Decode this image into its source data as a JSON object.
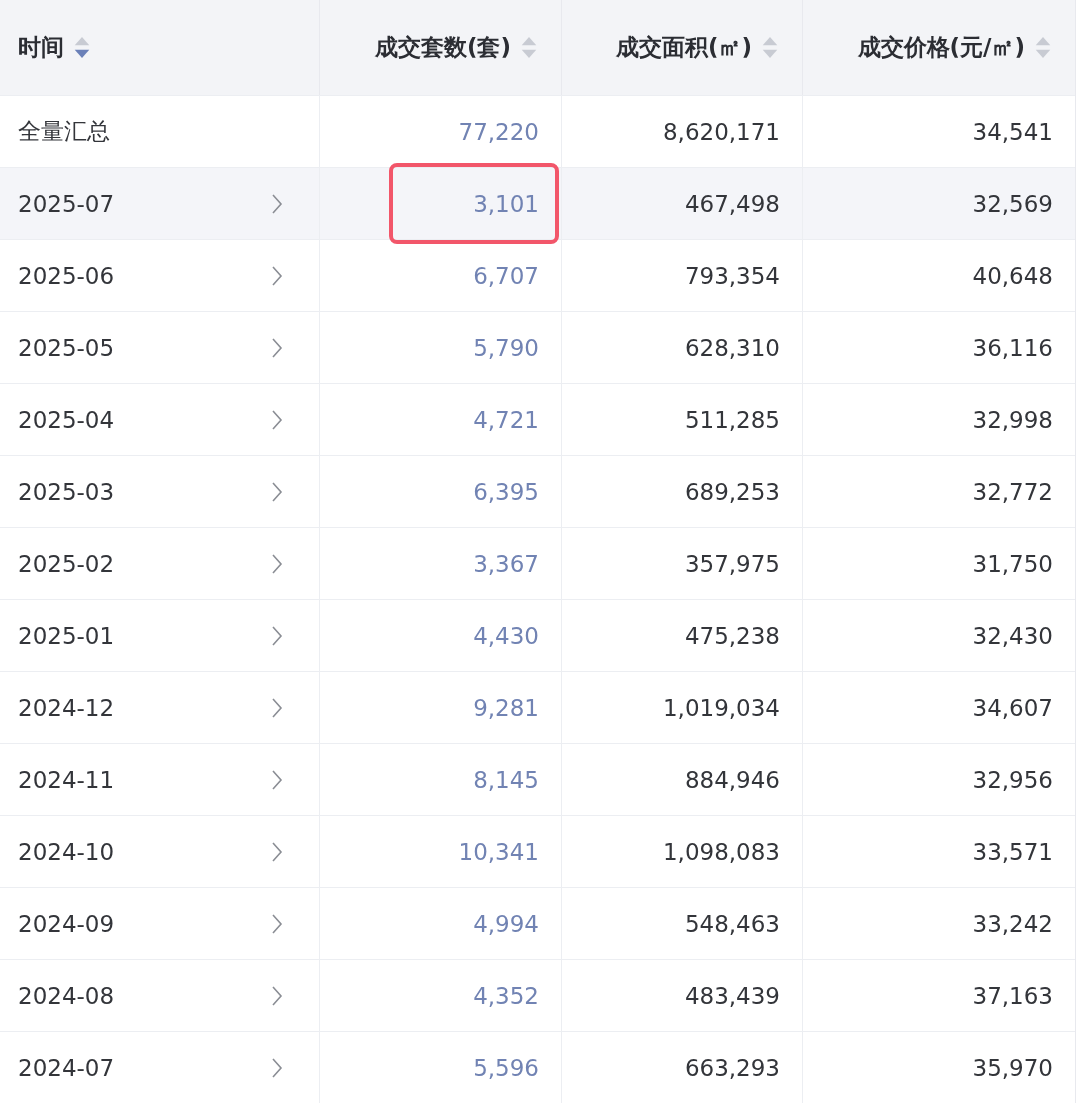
{
  "table": {
    "columns": [
      {
        "label": "时间",
        "sorted_descending": true
      },
      {
        "label": "成交套数(套)",
        "sorted_descending": false
      },
      {
        "label": "成交面积(㎡)",
        "sorted_descending": false
      },
      {
        "label": "成交价格(元/㎡)",
        "sorted_descending": false
      }
    ],
    "rows": [
      {
        "kind": "total",
        "period": "全量汇总",
        "units": "77,220",
        "area": "8,620,171",
        "price": "34,541",
        "selected": false,
        "marked": false
      },
      {
        "kind": "month",
        "period": "2025-07",
        "units": "3,101",
        "area": "467,498",
        "price": "32,569",
        "selected": true,
        "marked": true
      },
      {
        "kind": "month",
        "period": "2025-06",
        "units": "6,707",
        "area": "793,354",
        "price": "40,648",
        "selected": false,
        "marked": false
      },
      {
        "kind": "month",
        "period": "2025-05",
        "units": "5,790",
        "area": "628,310",
        "price": "36,116",
        "selected": false,
        "marked": false
      },
      {
        "kind": "month",
        "period": "2025-04",
        "units": "4,721",
        "area": "511,285",
        "price": "32,998",
        "selected": false,
        "marked": false
      },
      {
        "kind": "month",
        "period": "2025-03",
        "units": "6,395",
        "area": "689,253",
        "price": "32,772",
        "selected": false,
        "marked": false
      },
      {
        "kind": "month",
        "period": "2025-02",
        "units": "3,367",
        "area": "357,975",
        "price": "31,750",
        "selected": false,
        "marked": false
      },
      {
        "kind": "month",
        "period": "2025-01",
        "units": "4,430",
        "area": "475,238",
        "price": "32,430",
        "selected": false,
        "marked": false
      },
      {
        "kind": "month",
        "period": "2024-12",
        "units": "9,281",
        "area": "1,019,034",
        "price": "34,607",
        "selected": false,
        "marked": false
      },
      {
        "kind": "month",
        "period": "2024-11",
        "units": "8,145",
        "area": "884,946",
        "price": "32,956",
        "selected": false,
        "marked": false
      },
      {
        "kind": "month",
        "period": "2024-10",
        "units": "10,341",
        "area": "1,098,083",
        "price": "33,571",
        "selected": false,
        "marked": false
      },
      {
        "kind": "month",
        "period": "2024-09",
        "units": "4,994",
        "area": "548,463",
        "price": "33,242",
        "selected": false,
        "marked": false
      },
      {
        "kind": "month",
        "period": "2024-08",
        "units": "4,352",
        "area": "483,439",
        "price": "37,163",
        "selected": false,
        "marked": false
      },
      {
        "kind": "month",
        "period": "2024-07",
        "units": "5,596",
        "area": "663,293",
        "price": "35,970",
        "selected": false,
        "marked": false
      }
    ]
  }
}
